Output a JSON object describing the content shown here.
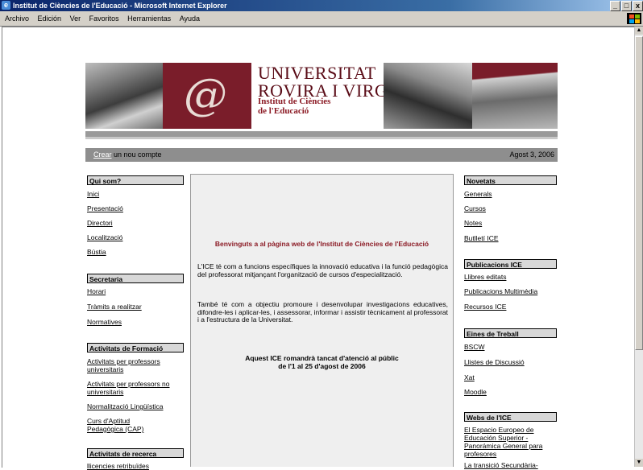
{
  "window": {
    "title": "Institut de Ciències de l'Educació - Microsoft Internet Explorer",
    "menu": [
      "Archivo",
      "Edición",
      "Ver",
      "Favoritos",
      "Herramientas",
      "Ayuda"
    ],
    "buttons": {
      "minimize": "_",
      "maximize": "□",
      "close": "x"
    }
  },
  "header": {
    "uni_line1": "UNIVERSITAT",
    "uni_line2": "ROVIRA I VIRGILI",
    "ice_line1": "Institut de Ciències",
    "ice_line2": "de l'Educació"
  },
  "account_bar": {
    "create_link": "Crear",
    "create_rest": " un nou compte",
    "date": "Agost 3, 2006"
  },
  "left": {
    "qui_som": {
      "title": "Qui som?",
      "links": [
        "Inici",
        "Presentació",
        "Directori",
        "Localització",
        "Bústia"
      ]
    },
    "secretaria": {
      "title": "Secretaria",
      "links": [
        "Horari",
        "Tràmits a realitzar",
        "Normatives"
      ]
    },
    "formacio": {
      "title": "Activitats de Formació",
      "links": [
        "Activitats per professors universitaris",
        "Activitats per professors no universitaris",
        "Normalització Lingüística",
        "Curs d'Aptitud Pedagògica (CAP)"
      ]
    },
    "recerca": {
      "title": "Activitats de recerca",
      "links": [
        "llicencies retribuïdes"
      ]
    }
  },
  "center": {
    "welcome": "Benvinguts a al pàgina web de l'Institut de Ciències de l'Educació",
    "para1": "L'ICE té com a funcions específiques la innovació educativa i la funció pedagògica del professorat mitjançant l'organització de cursos d'especialització.",
    "para2": "També té com a objectiu promoure i desenvolupar investigacions educatives, difondre-les i aplicar-les, i assessorar, informar i assistir tècnicament al professorat i a l'estructura de la Universitat.",
    "notice1": "Aquest ICE romandrà tancat d'atenció al públic",
    "notice2": "de l'1 al 25 d'agost de 2006"
  },
  "right": {
    "novetats": {
      "title": "Novetats",
      "links": [
        "Generals",
        "Cursos",
        "Notes",
        "Butlletí ICE"
      ]
    },
    "publicacions": {
      "title": "Publicacions ICE",
      "links": [
        "Llibres editats",
        "Publicacions Multimèdia",
        "Recursos ICE"
      ]
    },
    "eines": {
      "title": "Eines de Treball",
      "links": [
        "BSCW",
        "Llistes de Discussió",
        "Xat",
        "Moodle"
      ]
    },
    "webs": {
      "title": "Webs de l'ICE",
      "links": [
        "El Espacio Europeo de Educación Superior - Panorámica General para profesores",
        "La transició Secundària-"
      ]
    }
  }
}
